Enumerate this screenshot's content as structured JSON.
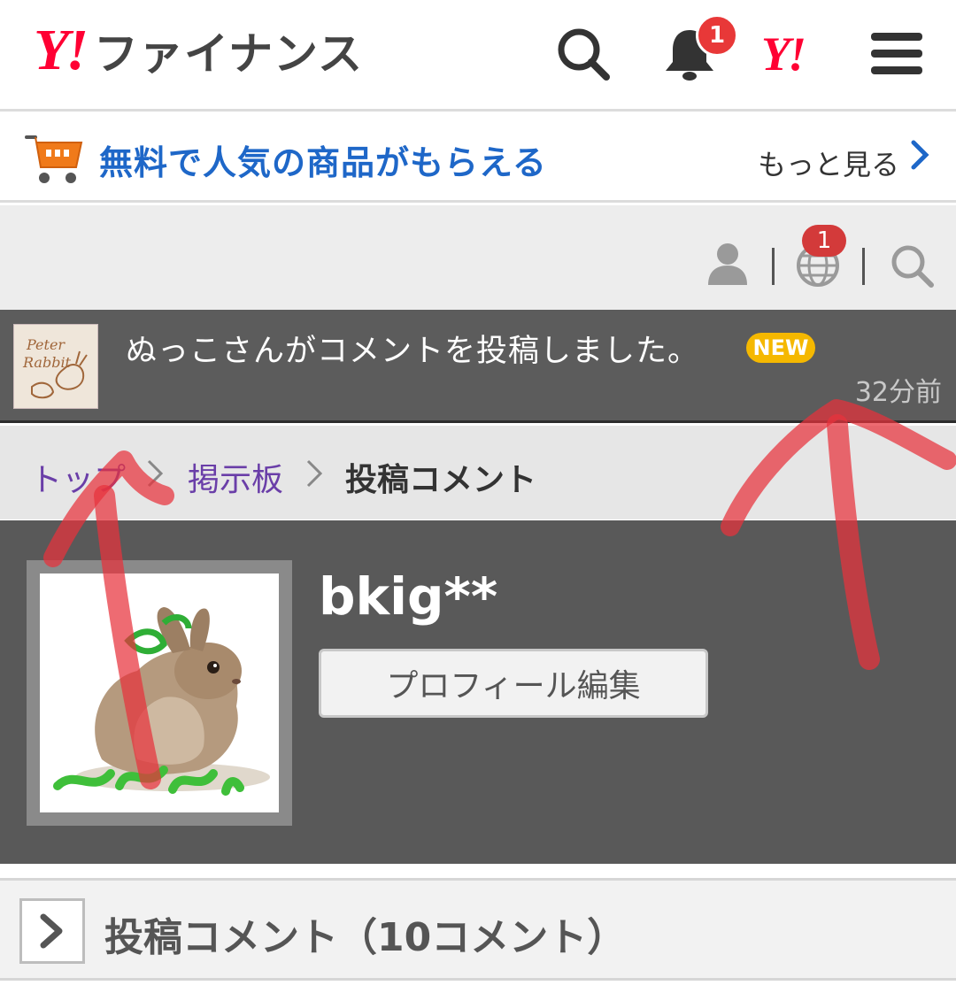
{
  "header": {
    "logo_mark": "Y!",
    "logo_text": "ファイナンス",
    "notification_count": "1",
    "yahoo_mark": "Y!"
  },
  "promo": {
    "text": "無料で人気の商品がもらえる",
    "more": "もっと見る"
  },
  "toolbar": {
    "globe_count": "1"
  },
  "notification": {
    "message": "ぬっこさんがコメントを投稿しました。",
    "badge": "NEW",
    "time": "32分前"
  },
  "breadcrumb": {
    "top": "トップ",
    "board": "掲示板",
    "current": "投稿コメント"
  },
  "profile": {
    "username": "bkig**",
    "edit_button": "プロフィール編集"
  },
  "section": {
    "title": "投稿コメント（10コメント）"
  },
  "colors": {
    "brand_red": "#ff0033",
    "link_blue": "#1e67c8",
    "breadcrumb_purple": "#6a3ea8",
    "new_badge": "#f5b800",
    "annotation_red": "#e8323c"
  }
}
